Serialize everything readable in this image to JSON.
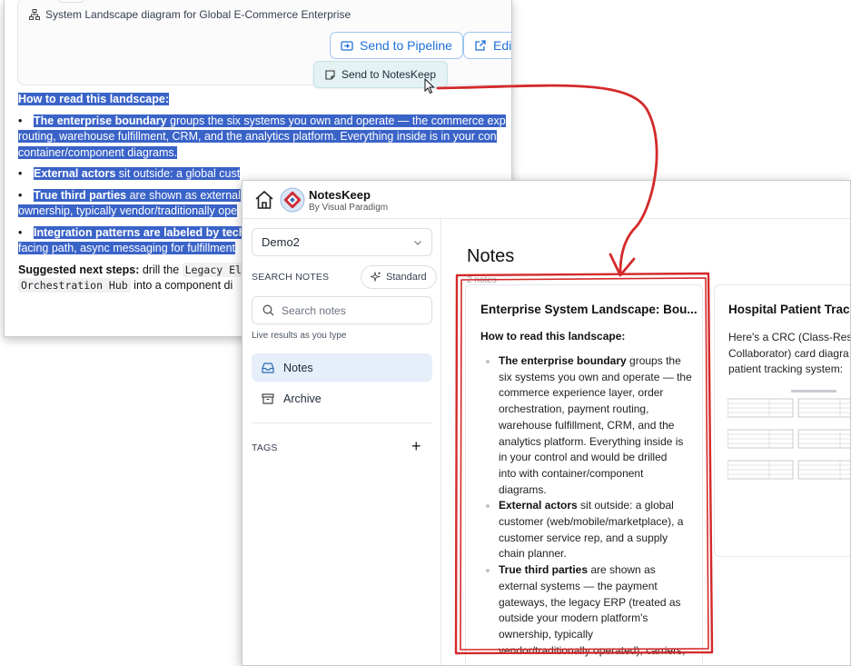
{
  "chat": {
    "diagram_title": "System Landscape diagram for Global E-Commerce Enterprise",
    "send_pipeline_label": "Send to Pipeline",
    "edit_label": "Edit",
    "send_noteskeep_label": "Send to NotesKeep",
    "content": {
      "heading": "How to read this landscape:",
      "b1_bold": "The enterprise boundary",
      "b1_l1": " groups the six systems you own and operate — the commerce exp",
      "b1_l2": "routing, warehouse fulfillment, CRM, and the analytics platform. Everything inside is in your con",
      "b1_l3": "container/component diagrams.",
      "b2_bold": "External actors",
      "b2_l1": " sit outside: a global cust",
      "b3_bold": "True third parties",
      "b3_l1": " are shown as external",
      "b3_l2": "ownership, typically vendor/traditionally ope",
      "b4_bold": "Integration patterns are labeled by tech",
      "b4_l2": "facing path, async messaging for fulfillment",
      "next_bold": "Suggested next steps:",
      "next_l1a": " drill the ",
      "next_code1": "Legacy El",
      "next_code2": "Orchestration Hub",
      "next_l2b": " into a component di"
    }
  },
  "noteskeep": {
    "app_name": "NotesKeep",
    "app_sub": "By Visual Paradigm",
    "workspace": "Demo2",
    "search_label": "SEARCH NOTES",
    "standard_label": "Standard",
    "search_placeholder": "Search notes",
    "live_hint": "Live results as you type",
    "nav_notes": "Notes",
    "nav_archive": "Archive",
    "tags_label": "TAGS",
    "tags_add": "+",
    "main_title": "Notes",
    "notes_count": "2 notes",
    "card1": {
      "title": "Enterprise System Landscape: Bou...",
      "subheading": "How to read this landscape:",
      "i1_bold": "The enterprise boundary",
      "i1_l1": " groups the",
      "i1_l2": "six systems you own and operate — the",
      "i1_l3": "commerce experience layer, order",
      "i1_l4": "orchestration, payment routing,",
      "i1_l5": "warehouse fulfillment, CRM, and the",
      "i1_l6": "analytics platform. Everything inside is",
      "i1_l7": "in your control and would be drilled",
      "i1_l8": "into with container/component",
      "i1_l9": "diagrams.",
      "i2_bold": "External actors",
      "i2_l1": " sit outside: a global",
      "i2_l2": "customer (web/mobile/marketplace), a",
      "i2_l3": "customer service rep, and a supply",
      "i2_l4": "chain planner.",
      "i3_bold": "True third parties",
      "i3_l1": " are shown as",
      "i3_l2": "external systems — the payment",
      "i3_l3": "gateways, the legacy ERP (treated as",
      "i3_l4": "outside your modern platform's",
      "i3_l5": "ownership, typically",
      "i3_l6": "vendor/traditionally operated), carriers,"
    },
    "card2": {
      "title": "Hospital Patient Track",
      "l1": "Here's a CRC (Class-Respo",
      "l2": "Collaborator) card diagra",
      "l3": "patient tracking system:"
    }
  },
  "colors": {
    "selection": "#3a63c8",
    "accent_blue": "#1d6fd8",
    "annotation_red": "#d42a2a",
    "nav_active_bg": "#e6eef9"
  }
}
